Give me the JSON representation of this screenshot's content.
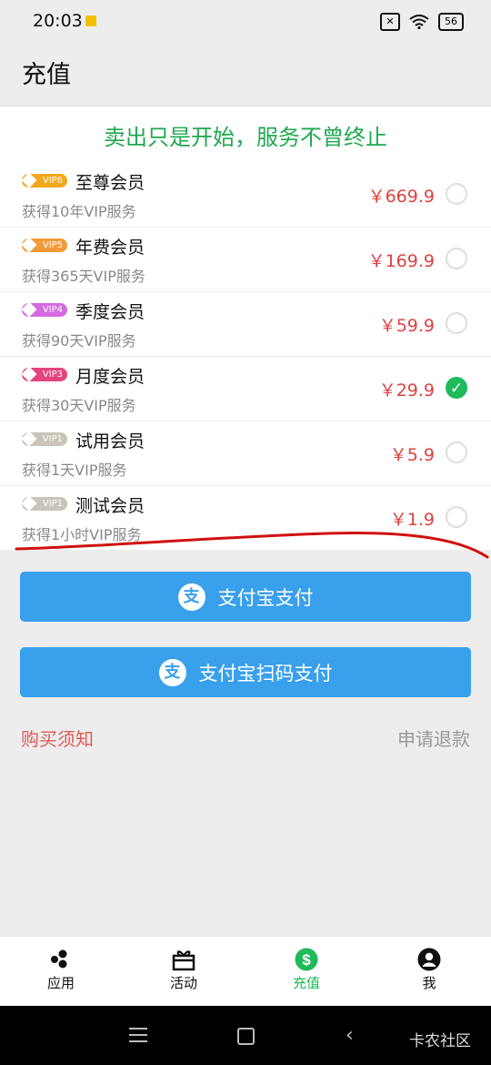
{
  "status": {
    "time": "20:03",
    "battery": "56"
  },
  "header": {
    "title": "充值"
  },
  "slogan": "卖出只是开始，服务不曾终止",
  "plans": [
    {
      "badge": "VIP6",
      "name": "至尊会员",
      "desc": "获得10年VIP服务",
      "price": "￥669.9",
      "selected": false,
      "badge_color": "#f2a81c"
    },
    {
      "badge": "VIP5",
      "name": "年费会员",
      "desc": "获得365天VIP服务",
      "price": "￥169.9",
      "selected": false,
      "badge_color": "#f29a3a"
    },
    {
      "badge": "VIP4",
      "name": "季度会员",
      "desc": "获得90天VIP服务",
      "price": "￥59.9",
      "selected": false,
      "badge_color": "#d56ae0"
    },
    {
      "badge": "VIP3",
      "name": "月度会员",
      "desc": "获得30天VIP服务",
      "price": "￥29.9",
      "selected": true,
      "badge_color": "#e2457d"
    },
    {
      "badge": "VIP1",
      "name": "试用会员",
      "desc": "获得1天VIP服务",
      "price": "￥5.9",
      "selected": false,
      "badge_color": "#c9c4b8"
    },
    {
      "badge": "VIP1",
      "name": "测试会员",
      "desc": "获得1小时VIP服务",
      "price": "￥1.9",
      "selected": false,
      "badge_color": "#c9c4b8"
    }
  ],
  "buttons": {
    "alipay": "支付宝支付",
    "alipay_qr": "支付宝扫码支付",
    "alipay_icon": "支"
  },
  "links": {
    "notice": "购买须知",
    "refund": "申请退款"
  },
  "tabs": [
    {
      "label": "应用",
      "icon": "apps-icon"
    },
    {
      "label": "活动",
      "icon": "gift-icon"
    },
    {
      "label": "充值",
      "icon": "dollar-icon",
      "active": true
    },
    {
      "label": "我",
      "icon": "user-icon"
    }
  ],
  "nav": {
    "text": "卡农社区"
  },
  "colors": {
    "accent": "#1fba5a",
    "price": "#e04040",
    "button": "#39a0ec",
    "annotation": "#d01010"
  }
}
